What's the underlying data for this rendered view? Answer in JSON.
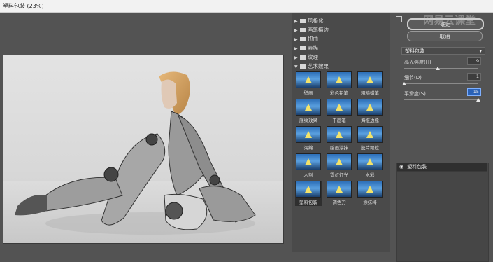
{
  "window": {
    "title": "塑料包装 (23%)"
  },
  "gallery": {
    "categories": [
      {
        "label": "风格化",
        "expanded": false
      },
      {
        "label": "画笔描边",
        "expanded": false
      },
      {
        "label": "扭曲",
        "expanded": false
      },
      {
        "label": "素描",
        "expanded": false
      },
      {
        "label": "纹理",
        "expanded": false
      },
      {
        "label": "艺术效果",
        "expanded": true
      }
    ],
    "filters": [
      {
        "label": "壁画"
      },
      {
        "label": "彩色铅笔"
      },
      {
        "label": "粗糙蜡笔"
      },
      {
        "label": "底纹效果"
      },
      {
        "label": "干画笔"
      },
      {
        "label": "海报边缘"
      },
      {
        "label": "海绵"
      },
      {
        "label": "绘画涂抹"
      },
      {
        "label": "胶片颗粒"
      },
      {
        "label": "木刻"
      },
      {
        "label": "霓虹灯光"
      },
      {
        "label": "水彩"
      },
      {
        "label": "塑料包装"
      },
      {
        "label": "调色刀"
      },
      {
        "label": "涂抹棒"
      }
    ],
    "selected": "塑料包装"
  },
  "settings": {
    "ok_label": "确定",
    "cancel_label": "取消",
    "filter_select": "塑料包装",
    "params": [
      {
        "label": "高光强度(H)",
        "value": "9",
        "fraction": 0.45
      },
      {
        "label": "细节(D)",
        "value": "1",
        "fraction": 0.0
      },
      {
        "label": "平滑度(S)",
        "value": "15",
        "fraction": 1.0
      }
    ]
  },
  "layers": {
    "items": [
      {
        "label": "塑料包装"
      }
    ]
  },
  "watermark": "网易云课堂"
}
